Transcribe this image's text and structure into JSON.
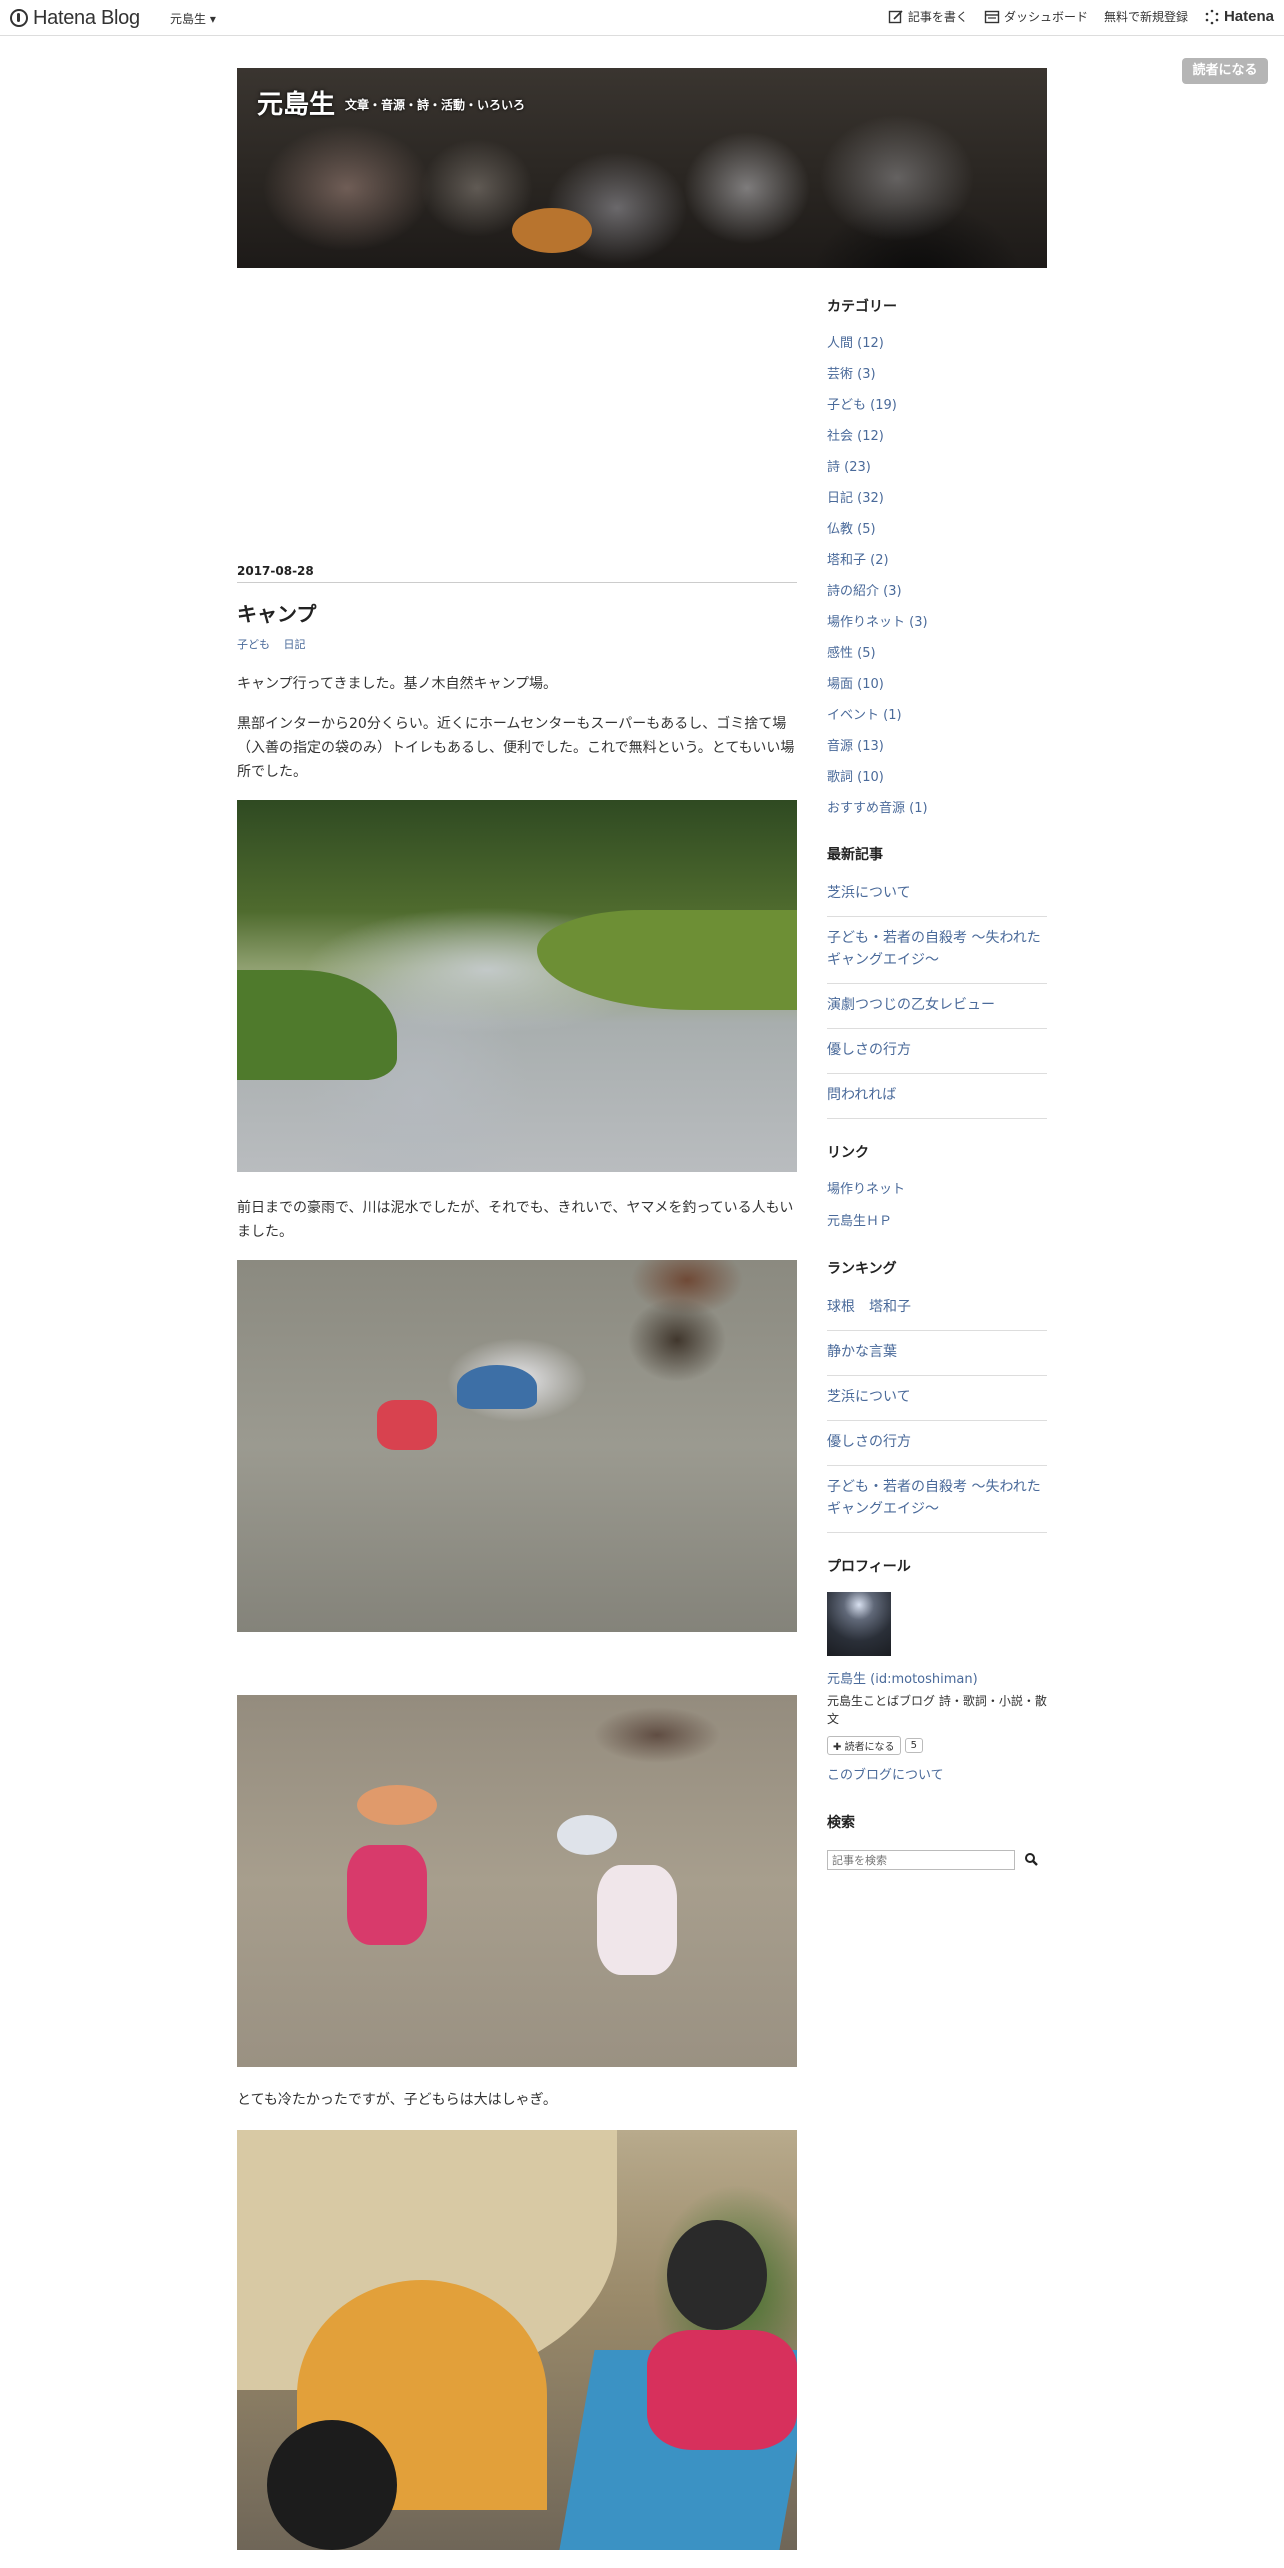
{
  "topbar": {
    "logo_text": "Hatena Blog",
    "blog_menu": "元島生 ▾",
    "write": "記事を書く",
    "dashboard": "ダッシュボード",
    "signup": "無料で新規登録",
    "hatena": "Hatena"
  },
  "subscribe_top": "読者になる",
  "header": {
    "title": "元島生",
    "description": "文章・音源・詩・活動・いろいろ"
  },
  "entry": {
    "date": "2017-08-28",
    "title": "キャンプ",
    "categories": [
      "子ども",
      "日記"
    ],
    "paragraphs": [
      "キャンプ行ってきました。基ノ木自然キャンプ場。",
      "黒部インターから20分くらい。近くにホームセンターもスーパーもあるし、ゴミ捨て場（入善の指定の袋のみ）トイレもあるし、便利でした。これで無料という。とてもいい場所でした。",
      "前日までの豪雨で、川は泥水でしたが、それでも、きれいで、ヤマメを釣っている人もいました。",
      "とても冷たかったですが、子どもらは大はしゃぎ。"
    ]
  },
  "sidebar": {
    "categories_title": "カテゴリー",
    "categories": [
      "人間 (12)",
      "芸術 (3)",
      "子ども (19)",
      "社会 (12)",
      "詩 (23)",
      "日記 (32)",
      "仏教 (5)",
      "塔和子 (2)",
      "詩の紹介 (3)",
      "場作りネット (3)",
      "感性 (5)",
      "場面 (10)",
      "イベント (1)",
      "音源 (13)",
      "歌詞 (10)",
      "おすすめ音源 (1)"
    ],
    "recent_title": "最新記事",
    "recent": [
      "芝浜について",
      "子ども・若者の自殺考 ～失われたギャングエイジ～",
      "演劇つつじの乙女レビュー",
      "優しさの行方",
      "問われれば"
    ],
    "links_title": "リンク",
    "links": [
      "場作りネット",
      "元島生ＨＰ"
    ],
    "ranking_title": "ランキング",
    "ranking": [
      "球根　塔和子",
      "静かな言葉",
      "芝浜について",
      "優しさの行方",
      "子ども・若者の自殺考 ～失われたギャングエイジ～"
    ],
    "profile_title": "プロフィール",
    "profile_name": "元島生 (id:motoshiman)",
    "profile_desc": "元島生ことばブログ 詩・歌詞・小説・散文",
    "subscribe_label": "読者になる",
    "subscriber_count": "5",
    "about": "このブログについて",
    "search_title": "検索",
    "search_placeholder": "記事を検索"
  }
}
